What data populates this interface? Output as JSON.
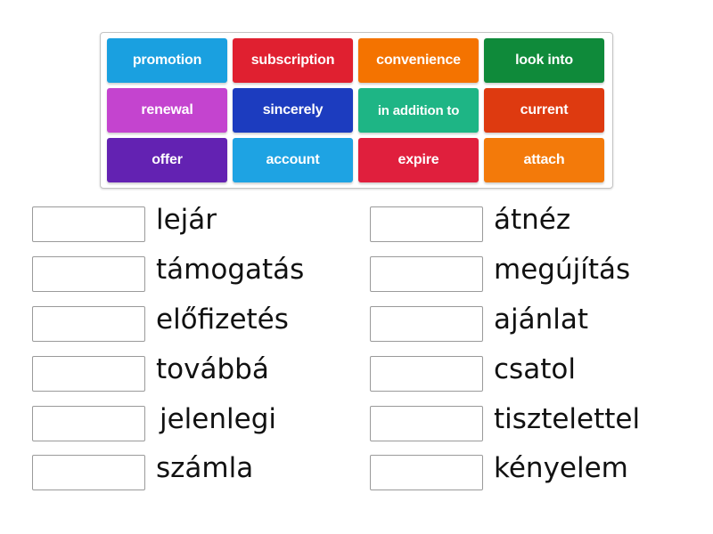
{
  "tiles": [
    {
      "label": "promotion",
      "color": "#1aa0e0"
    },
    {
      "label": "subscription",
      "color": "#e02030"
    },
    {
      "label": "convenience",
      "color": "#f47300"
    },
    {
      "label": "look into",
      "color": "#0f8a3a"
    },
    {
      "label": "renewal",
      "color": "#c444cf"
    },
    {
      "label": "sincerely",
      "color": "#1c3cbf"
    },
    {
      "label": "in addition to",
      "color": "#1eb585"
    },
    {
      "label": "current",
      "color": "#de3a10"
    },
    {
      "label": "offer",
      "color": "#6322b2"
    },
    {
      "label": "account",
      "color": "#1ea3e3"
    },
    {
      "label": "expire",
      "color": "#e01f3d"
    },
    {
      "label": "attach",
      "color": "#f37a0a"
    }
  ],
  "targets_left": [
    {
      "label": "lejár",
      "value": ""
    },
    {
      "label": "támogatás",
      "value": ""
    },
    {
      "label": "előfizetés",
      "value": ""
    },
    {
      "label": "továbbá",
      "value": ""
    },
    {
      "label": "jelenlegi",
      "value": ""
    },
    {
      "label": "számla",
      "value": ""
    }
  ],
  "targets_right": [
    {
      "label": "átnéz",
      "value": ""
    },
    {
      "label": "megújítás",
      "value": ""
    },
    {
      "label": "ajánlat",
      "value": ""
    },
    {
      "label": "csatol",
      "value": ""
    },
    {
      "label": "tisztelettel",
      "value": ""
    },
    {
      "label": "kényelem",
      "value": ""
    }
  ]
}
